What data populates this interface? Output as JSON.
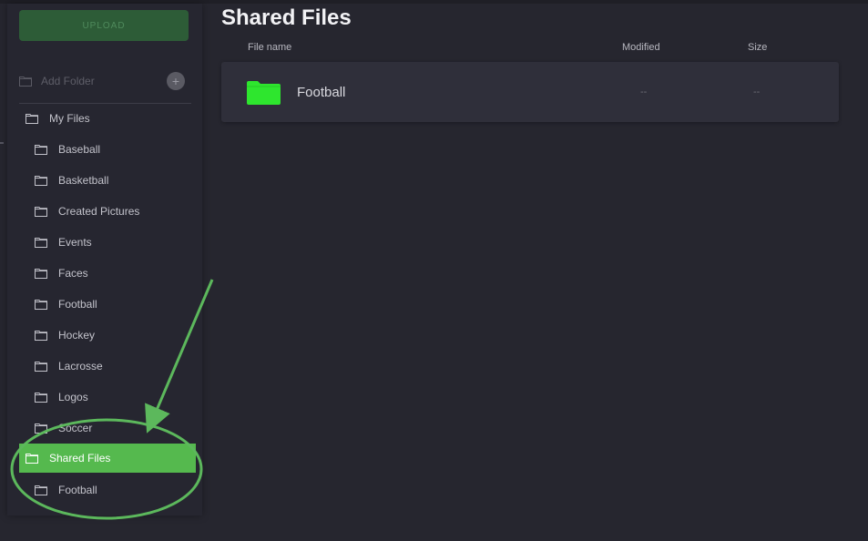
{
  "sidebar": {
    "upload_label": "UPLOAD",
    "add_folder_label": "Add Folder",
    "add_folder_plus": "+",
    "tree": [
      {
        "label": "My Files",
        "level": "root",
        "active": false
      },
      {
        "label": "Baseball",
        "level": "child",
        "active": false
      },
      {
        "label": "Basketball",
        "level": "child",
        "active": false
      },
      {
        "label": "Created Pictures",
        "level": "child",
        "active": false
      },
      {
        "label": "Events",
        "level": "child",
        "active": false
      },
      {
        "label": "Faces",
        "level": "child",
        "active": false
      },
      {
        "label": "Football",
        "level": "child",
        "active": false
      },
      {
        "label": "Hockey",
        "level": "child",
        "active": false
      },
      {
        "label": "Lacrosse",
        "level": "child",
        "active": false
      },
      {
        "label": "Logos",
        "level": "child",
        "active": false
      },
      {
        "label": "Soccer",
        "level": "child",
        "active": false
      },
      {
        "label": "Shared Files",
        "level": "root",
        "active": true
      },
      {
        "label": "Football",
        "level": "child",
        "active": false
      }
    ]
  },
  "main": {
    "title": "Shared Files",
    "columns": {
      "name": "File name",
      "modified": "Modified",
      "size": "Size"
    },
    "rows": [
      {
        "name": "Football",
        "modified": "--",
        "size": "--",
        "icon": "folder-icon"
      }
    ]
  },
  "colors": {
    "accent": "#55b94e",
    "folder": "#2ee62e",
    "annotation": "#5cb85c",
    "background": "#26262f"
  }
}
